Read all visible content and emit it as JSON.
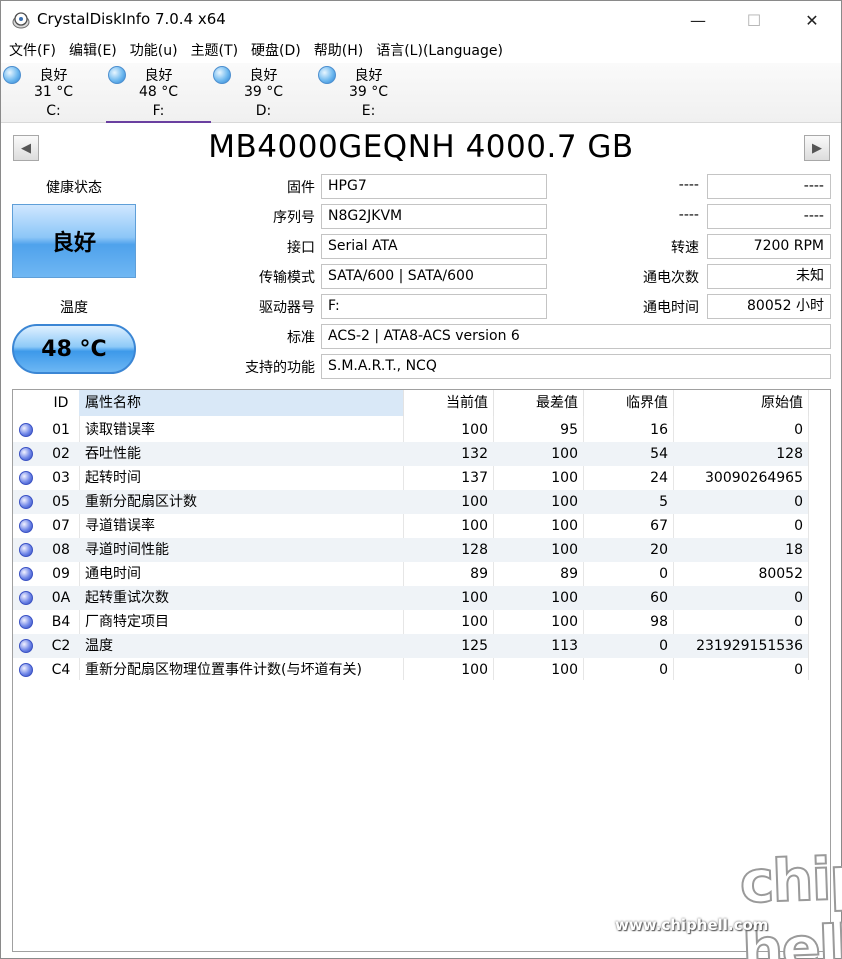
{
  "titlebar": {
    "title": "CrystalDiskInfo 7.0.4 x64",
    "minimize_glyph": "—",
    "maximize_glyph": "☐",
    "close_glyph": "✕"
  },
  "menu": [
    "文件(F)",
    "编辑(E)",
    "功能(u)",
    "主题(T)",
    "硬盘(D)",
    "帮助(H)",
    "语言(L)(Language)"
  ],
  "disks": [
    {
      "status": "良好",
      "temp": "31 °C",
      "drive": "C:"
    },
    {
      "status": "良好",
      "temp": "48 °C",
      "drive": "F:"
    },
    {
      "status": "良好",
      "temp": "39 °C",
      "drive": "D:"
    },
    {
      "status": "良好",
      "temp": "39 °C",
      "drive": "E:"
    }
  ],
  "model": "MB4000GEQNH 4000.7 GB",
  "health": {
    "label": "健康状态",
    "value": "良好"
  },
  "temperature": {
    "label": "温度",
    "value": "48 °C"
  },
  "info": {
    "firmware": {
      "label": "固件",
      "value": "HPG7"
    },
    "serial": {
      "label": "序列号",
      "value": "N8G2JKVM"
    },
    "interface": {
      "label": "接口",
      "value": "Serial ATA"
    },
    "transfer": {
      "label": "传输模式",
      "value": "SATA/600 | SATA/600"
    },
    "drive_letter": {
      "label": "驱动器号",
      "value": "F:"
    },
    "standard": {
      "label": "标准",
      "value": "ACS-2 | ATA8-ACS version 6"
    },
    "features": {
      "label": "支持的功能",
      "value": "S.M.A.R.T., NCQ"
    },
    "right1": {
      "label": "----",
      "value": "----"
    },
    "right2": {
      "label": "----",
      "value": "----"
    },
    "rotation": {
      "label": "转速",
      "value": "7200 RPM"
    },
    "power_count": {
      "label": "通电次数",
      "value": "未知"
    },
    "power_hours": {
      "label": "通电时间",
      "value": "80052 小时"
    }
  },
  "table": {
    "headers": {
      "id": "ID",
      "name": "属性名称",
      "current": "当前值",
      "worst": "最差值",
      "threshold": "临界值",
      "raw": "原始值"
    },
    "rows": [
      {
        "id": "01",
        "name": "读取错误率",
        "current": "100",
        "worst": "95",
        "threshold": "16",
        "raw": "0"
      },
      {
        "id": "02",
        "name": "吞吐性能",
        "current": "132",
        "worst": "100",
        "threshold": "54",
        "raw": "128"
      },
      {
        "id": "03",
        "name": "起转时间",
        "current": "137",
        "worst": "100",
        "threshold": "24",
        "raw": "30090264965"
      },
      {
        "id": "05",
        "name": "重新分配扇区计数",
        "current": "100",
        "worst": "100",
        "threshold": "5",
        "raw": "0"
      },
      {
        "id": "07",
        "name": "寻道错误率",
        "current": "100",
        "worst": "100",
        "threshold": "67",
        "raw": "0"
      },
      {
        "id": "08",
        "name": "寻道时间性能",
        "current": "128",
        "worst": "100",
        "threshold": "20",
        "raw": "18"
      },
      {
        "id": "09",
        "name": "通电时间",
        "current": "89",
        "worst": "89",
        "threshold": "0",
        "raw": "80052"
      },
      {
        "id": "0A",
        "name": "起转重试次数",
        "current": "100",
        "worst": "100",
        "threshold": "60",
        "raw": "0"
      },
      {
        "id": "B4",
        "name": "厂商特定项目",
        "current": "100",
        "worst": "100",
        "threshold": "98",
        "raw": "0"
      },
      {
        "id": "C2",
        "name": "温度",
        "current": "125",
        "worst": "113",
        "threshold": "0",
        "raw": "231929151536"
      },
      {
        "id": "C4",
        "name": "重新分配扇区物理位置事件计数(与坏道有关)",
        "current": "100",
        "worst": "100",
        "threshold": "0",
        "raw": "0"
      }
    ]
  },
  "watermark": {
    "logo": "chip hell",
    "url": "www.chiphell.com"
  },
  "colors": {
    "health_blue": "#4fa2ec",
    "status_dot": "#2d46b8",
    "active_tab": "#6a3fa0"
  },
  "icons": {
    "disk_status": "blue-ball-icon",
    "nav_prev": "arrow-left-icon",
    "nav_next": "arrow-right-icon"
  }
}
